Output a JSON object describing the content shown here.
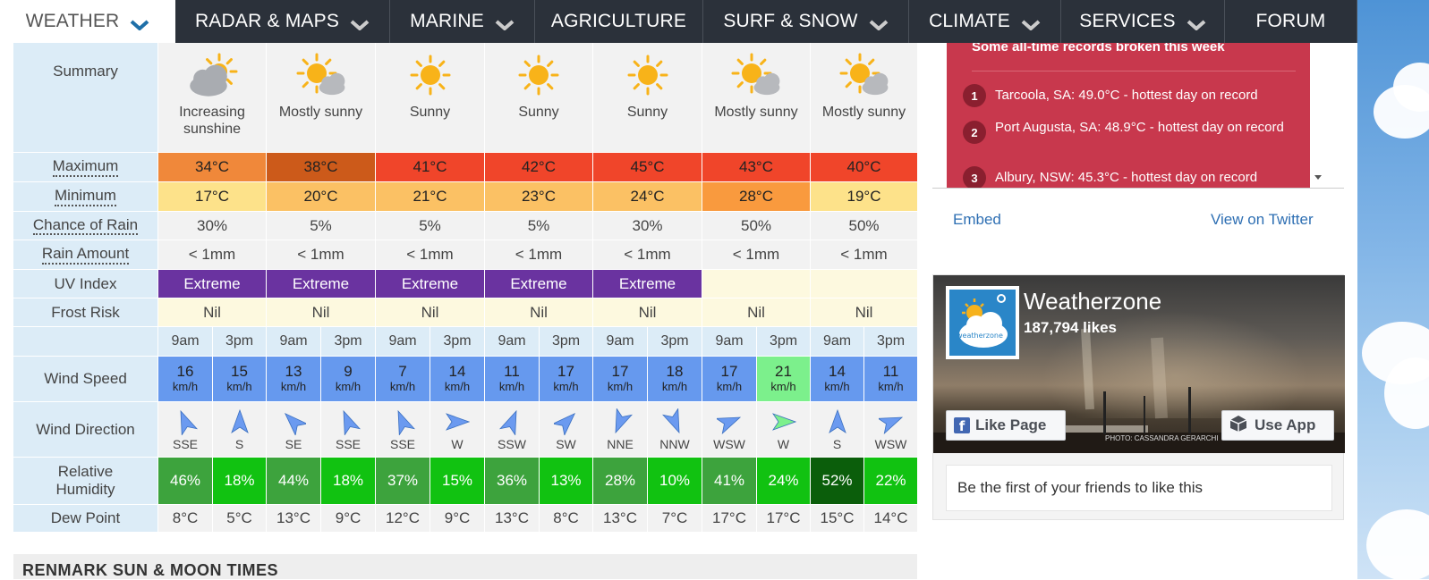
{
  "nav": {
    "items": [
      {
        "label": "WEATHER",
        "has_dropdown": true,
        "active": true
      },
      {
        "label": "RADAR & MAPS",
        "has_dropdown": true
      },
      {
        "label": "MARINE",
        "has_dropdown": true
      },
      {
        "label": "AGRICULTURE",
        "has_dropdown": false
      },
      {
        "label": "SURF & SNOW",
        "has_dropdown": true
      },
      {
        "label": "CLIMATE",
        "has_dropdown": true
      },
      {
        "label": "SERVICES",
        "has_dropdown": true
      },
      {
        "label": "FORUM",
        "has_dropdown": false
      }
    ]
  },
  "forecast": {
    "labels": {
      "summary": "Summary",
      "maximum": "Maximum",
      "minimum": "Minimum",
      "chance_of_rain": "Chance of Rain",
      "rain_amount": "Rain Amount",
      "uv_index": "UV Index",
      "frost_risk": "Frost Risk",
      "wind_speed": "Wind Speed",
      "wind_direction": "Wind Direction",
      "relative_humidity": "Relative Humidity",
      "dew_point": "Dew Point"
    },
    "days": [
      {
        "icon": "cloud-sun-icon",
        "summary": "Increasing sunshine",
        "max": "34°C",
        "max_color": "#f0883a",
        "min": "17°C",
        "min_color": "#fde28a",
        "rain_chance": "30%",
        "rain_amount": "< 1mm",
        "uv": "Extreme",
        "frost": "Nil"
      },
      {
        "icon": "sun-cloud-icon",
        "summary": "Mostly sunny",
        "max": "38°C",
        "max_color": "#cc5a1a",
        "min": "20°C",
        "min_color": "#fbc164",
        "rain_chance": "5%",
        "rain_amount": "< 1mm",
        "uv": "Extreme",
        "frost": "Nil"
      },
      {
        "icon": "sun-icon",
        "summary": "Sunny",
        "max": "41°C",
        "max_color": "#f0452a",
        "min": "21°C",
        "min_color": "#fbc164",
        "rain_chance": "5%",
        "rain_amount": "< 1mm",
        "uv": "Extreme",
        "frost": "Nil"
      },
      {
        "icon": "sun-icon",
        "summary": "Sunny",
        "max": "42°C",
        "max_color": "#f0452a",
        "min": "23°C",
        "min_color": "#fbc164",
        "rain_chance": "5%",
        "rain_amount": "< 1mm",
        "uv": "Extreme",
        "frost": "Nil"
      },
      {
        "icon": "sun-icon",
        "summary": "Sunny",
        "max": "45°C",
        "max_color": "#f0452a",
        "min": "24°C",
        "min_color": "#fbc164",
        "rain_chance": "30%",
        "rain_amount": "< 1mm",
        "uv": "Extreme",
        "frost": "Nil"
      },
      {
        "icon": "sun-cloud-icon",
        "summary": "Mostly sunny",
        "max": "43°C",
        "max_color": "#f0452a",
        "min": "28°C",
        "min_color": "#f99a3e",
        "rain_chance": "50%",
        "rain_amount": "< 1mm",
        "uv": "",
        "frost": "Nil"
      },
      {
        "icon": "sun-cloud-icon",
        "summary": "Mostly sunny",
        "max": "40°C",
        "max_color": "#f0452a",
        "min": "19°C",
        "min_color": "#fde28a",
        "rain_chance": "50%",
        "rain_amount": "< 1mm",
        "uv": "",
        "frost": "Nil"
      }
    ],
    "uv_color": "#6a33a0",
    "periods": [
      {
        "time": "9am",
        "wind_speed": "16",
        "wind_dir": "SSE",
        "humidity": "46%",
        "humidity_color": "#3da33d",
        "dew": "8°C"
      },
      {
        "time": "3pm",
        "wind_speed": "15",
        "wind_dir": "S",
        "humidity": "18%",
        "humidity_color": "#11c211",
        "dew": "5°C"
      },
      {
        "time": "9am",
        "wind_speed": "13",
        "wind_dir": "SE",
        "humidity": "44%",
        "humidity_color": "#3da33d",
        "dew": "13°C"
      },
      {
        "time": "3pm",
        "wind_speed": "9",
        "wind_dir": "SSE",
        "humidity": "18%",
        "humidity_color": "#11c211",
        "dew": "9°C"
      },
      {
        "time": "9am",
        "wind_speed": "7",
        "wind_dir": "SSE",
        "humidity": "37%",
        "humidity_color": "#3da33d",
        "dew": "12°C"
      },
      {
        "time": "3pm",
        "wind_speed": "14",
        "wind_dir": "W",
        "humidity": "15%",
        "humidity_color": "#11c211",
        "dew": "9°C"
      },
      {
        "time": "9am",
        "wind_speed": "11",
        "wind_dir": "SSW",
        "humidity": "36%",
        "humidity_color": "#3da33d",
        "dew": "13°C"
      },
      {
        "time": "3pm",
        "wind_speed": "17",
        "wind_dir": "SW",
        "humidity": "13%",
        "humidity_color": "#11c211",
        "dew": "8°C"
      },
      {
        "time": "9am",
        "wind_speed": "17",
        "wind_dir": "NNE",
        "humidity": "28%",
        "humidity_color": "#3da33d",
        "dew": "13°C"
      },
      {
        "time": "3pm",
        "wind_speed": "18",
        "wind_dir": "NNW",
        "humidity": "10%",
        "humidity_color": "#11c211",
        "dew": "7°C"
      },
      {
        "time": "9am",
        "wind_speed": "17",
        "wind_dir": "WSW",
        "humidity": "41%",
        "humidity_color": "#3da33d",
        "dew": "17°C"
      },
      {
        "time": "3pm",
        "wind_speed": "21",
        "wind_dir": "W",
        "humidity": "24%",
        "humidity_color": "#11c211",
        "dew": "17°C",
        "highlight": true
      },
      {
        "time": "9am",
        "wind_speed": "14",
        "wind_dir": "S",
        "humidity": "52%",
        "humidity_color": "#0b5e0b",
        "dew": "15°C"
      },
      {
        "time": "3pm",
        "wind_speed": "11",
        "wind_dir": "WSW",
        "humidity": "22%",
        "humidity_color": "#11c211",
        "dew": "14°C"
      }
    ],
    "wind_unit": "km/h",
    "wind_speed_color": "#6699ee",
    "wind_highlight_color": "#7cf08c"
  },
  "sun_moon": {
    "title": "RENMARK SUN & MOON TIMES"
  },
  "twitter": {
    "heading": "Some all-time records broken this week",
    "records": [
      {
        "num": "1",
        "text": "Tarcoola, SA: 49.0°C - hottest day on record"
      },
      {
        "num": "2",
        "text": "Port Augusta, SA: 48.9°C - hottest day on record"
      },
      {
        "num": "3",
        "text": "Albury, NSW: 45.3°C - hottest day on record"
      }
    ],
    "embed": "Embed",
    "view_on": "View on Twitter"
  },
  "facebook": {
    "page_name": "Weatherzone",
    "likes": "187,794 likes",
    "logo_text": "weatherzone",
    "like_button": "Like Page",
    "app_button": "Use App",
    "photo_credit": "PHOTO: CASSANDRA GERARCHI",
    "friends_text": "Be the first of your friends to like this"
  }
}
